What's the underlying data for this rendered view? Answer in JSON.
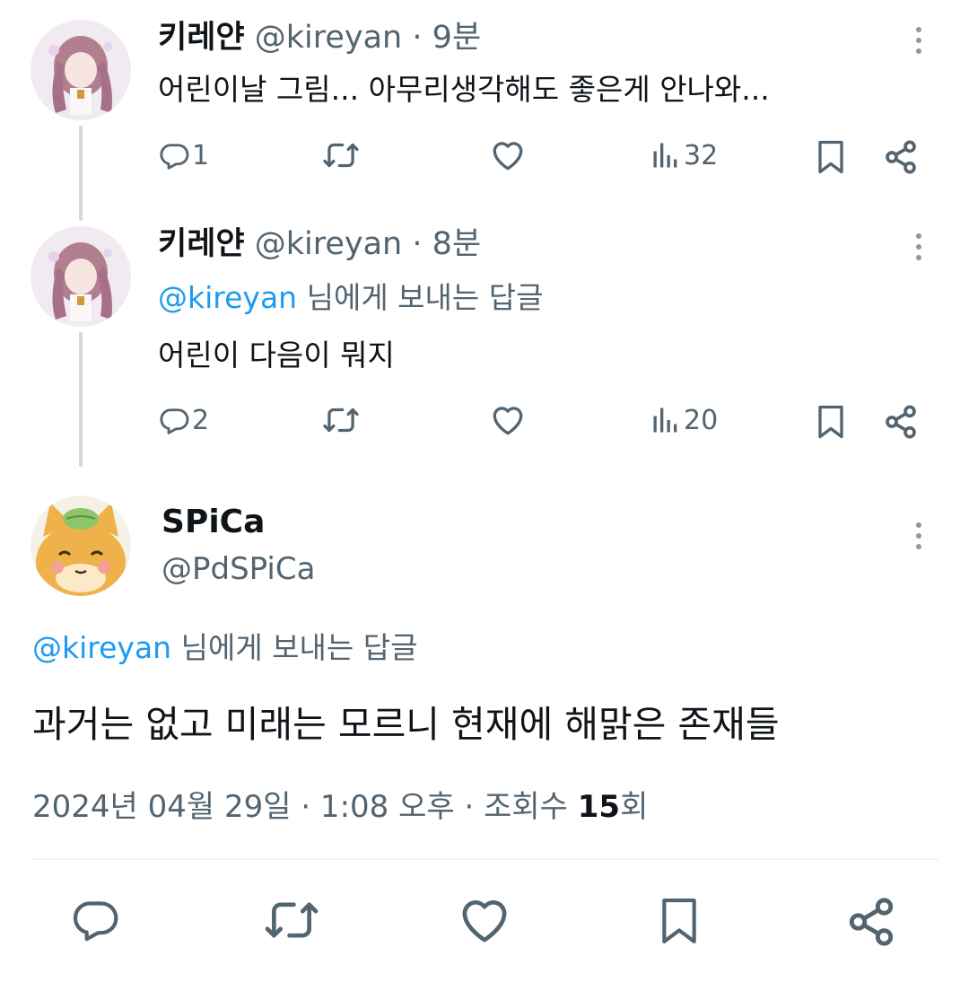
{
  "thread": [
    {
      "display_name": "키레얀",
      "handle": "@kireyan",
      "time": "9분",
      "reply_to": null,
      "text": "어린이날 그림... 아무리생각해도 좋은게 안나와...",
      "replies": "1",
      "views": "32"
    },
    {
      "display_name": "키레얀",
      "handle": "@kireyan",
      "time": "8분",
      "reply_to": {
        "mention": "@kireyan",
        "suffix": "님에게 보내는 답글"
      },
      "text": "어린이 다음이 뭐지",
      "replies": "2",
      "views": "20"
    }
  ],
  "main_tweet": {
    "display_name": "SPiCa",
    "handle": "@PdSPiCa",
    "reply_to": {
      "mention": "@kireyan",
      "suffix": "님에게 보내는 답글"
    },
    "text": "과거는 없고 미래는 모르니 현재에 해맑은 존재들",
    "timestamp": "2024년 04월 29일 · 1:08 오후 · 조회수",
    "views_count": "15",
    "views_suffix": "회"
  },
  "icons": {
    "reply": "speech-bubble-icon",
    "retweet": "retweet-arrows-icon",
    "like": "heart-icon",
    "views": "bar-chart-icon",
    "bookmark": "bookmark-icon",
    "share": "share-icon",
    "more": "vertical-dots-icon"
  },
  "colors": {
    "accent": "#1d9bf0",
    "secondary_text": "#536471",
    "icon": "#536471",
    "thread_line": "#cfd9de"
  }
}
